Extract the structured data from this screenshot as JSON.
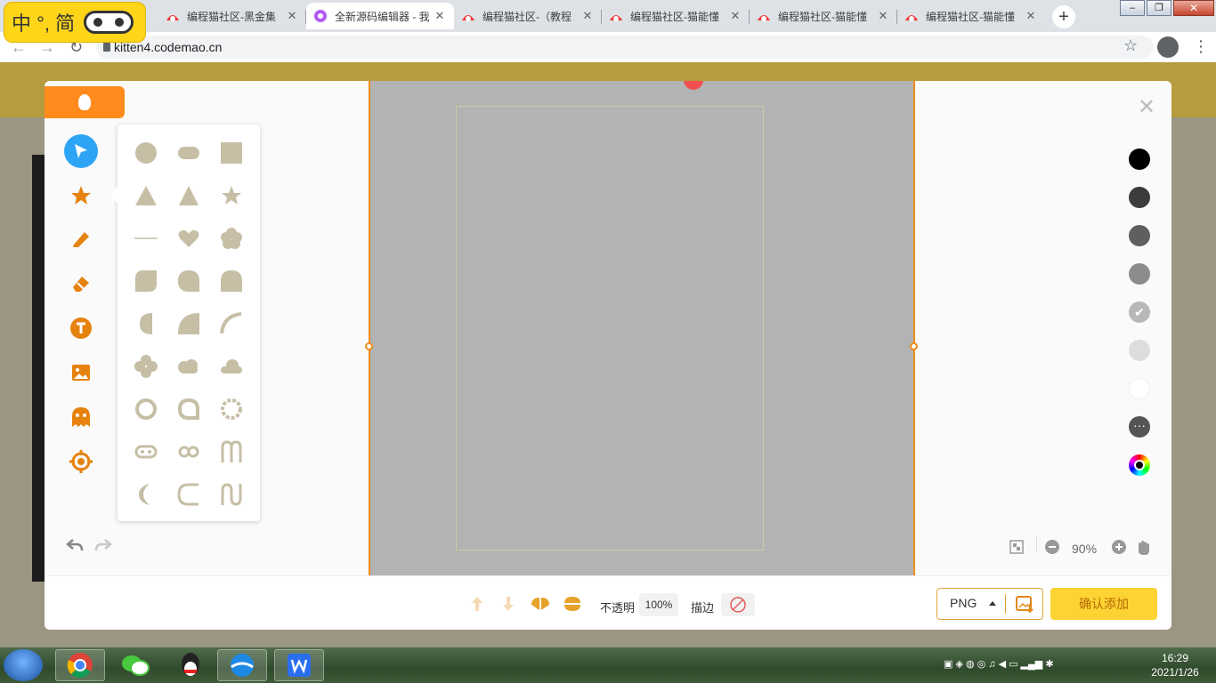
{
  "browser": {
    "tabs": [
      {
        "title": "编程猫社区-黑金集"
      },
      {
        "title": "全新源码编辑器 - 我"
      },
      {
        "title": "编程猫社区-（教程"
      },
      {
        "title": "编程猫社区-猫能懂"
      },
      {
        "title": "编程猫社区-猫能懂"
      },
      {
        "title": "编程猫社区-猫能懂"
      }
    ],
    "new_tab": "+",
    "address": "kitten4.codemao.cn"
  },
  "ime": {
    "label": "中 °, 简"
  },
  "editor": {
    "tools": [
      "select",
      "shape",
      "brush",
      "eraser",
      "text",
      "image",
      "character",
      "target"
    ],
    "selected_tool": "select",
    "shape_panel": [
      "circle",
      "rounded-rect",
      "square",
      "triangle",
      "triangle-2",
      "star",
      "line",
      "heart",
      "flower",
      "leaf",
      "drop",
      "arch",
      "half-circle",
      "quarter",
      "arc",
      "cross",
      "cloud",
      "cloud-2",
      "ring",
      "speech-ring",
      "gear-ring",
      "pill-ring",
      "double-ring",
      "m-shape",
      "crescent",
      "c-shape",
      "n-shape"
    ],
    "palette": [
      "#000000",
      "#3c3c3c",
      "#5f5f5f",
      "#8c8c8c",
      "#b8b8b8",
      "#dddddd",
      "#ffffff",
      "#555555"
    ],
    "zoom": "90%",
    "opacity_label": "不透明",
    "opacity_value": "100%",
    "stroke_label": "描边",
    "format": "PNG",
    "confirm": "确认添加"
  },
  "taskbar": {
    "clock_time": "16:29",
    "clock_date": "2021/1/26"
  }
}
